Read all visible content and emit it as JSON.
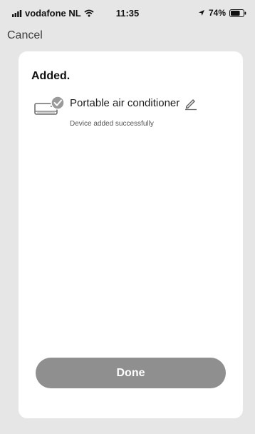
{
  "status_bar": {
    "carrier": "vodafone NL",
    "time": "11:35",
    "battery_percent": "74%",
    "icons": [
      "signal-icon",
      "wifi-icon",
      "location-arrow-icon",
      "battery-icon"
    ],
    "battery_level": 0.74
  },
  "nav": {
    "cancel_label": "Cancel"
  },
  "result": {
    "title": "Added.",
    "device": {
      "name": "Portable air conditioner",
      "status": "Device added successfully",
      "icon": "air-conditioner-icon",
      "badge_icon": "checkmark-icon",
      "edit_icon": "pencil-icon"
    }
  },
  "actions": {
    "done_label": "Done"
  },
  "colors": {
    "background": "#e6e6e6",
    "card": "#ffffff",
    "button": "#8f8f8f",
    "badge": "#9a9a9a"
  }
}
